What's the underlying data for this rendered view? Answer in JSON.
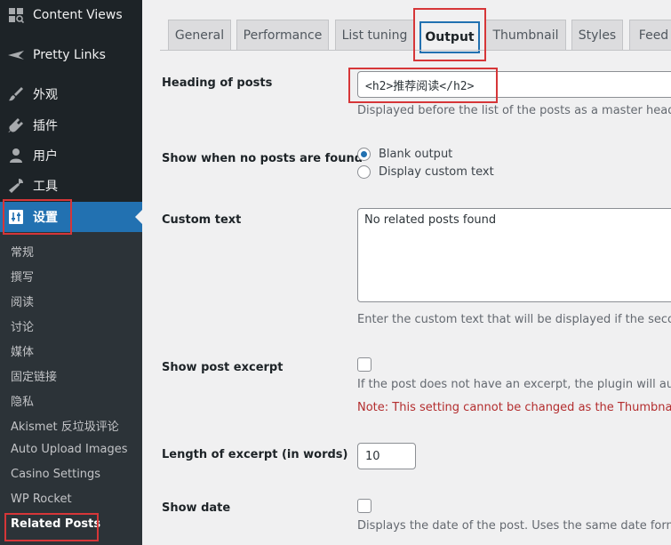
{
  "sidebar": {
    "menu": [
      {
        "label": "Content Views",
        "icon": "grid-icon"
      },
      {
        "label": "Pretty Links",
        "icon": "star-icon"
      },
      {
        "label": "外观",
        "icon": "paintbrush-icon"
      },
      {
        "label": "插件",
        "icon": "plugin-icon"
      },
      {
        "label": "用户",
        "icon": "user-icon"
      },
      {
        "label": "工具",
        "icon": "wrench-icon"
      },
      {
        "label": "设置",
        "icon": "settings-icon"
      }
    ],
    "submenu": [
      "常规",
      "撰写",
      "阅读",
      "讨论",
      "媒体",
      "固定链接",
      "隐私",
      "Akismet 反垃圾评论",
      "Auto Upload Images",
      "Casino Settings",
      "WP Rocket",
      "Related Posts"
    ]
  },
  "tabs": [
    "General",
    "Performance",
    "List tuning",
    "Output",
    "Thumbnail",
    "Styles",
    "Feed"
  ],
  "form": {
    "heading": {
      "label": "Heading of posts",
      "value": "<h2>推荐阅读</h2>",
      "desc": "Displayed before the list of the posts as a master heading"
    },
    "no_posts": {
      "label": "Show when no posts are found",
      "options": [
        "Blank output",
        "Display custom text"
      ],
      "selected": "Blank output"
    },
    "custom_text": {
      "label": "Custom text",
      "value": "No related posts found",
      "desc": "Enter the custom text that will be displayed if the second"
    },
    "excerpt": {
      "label": "Show post excerpt",
      "desc": "If the post does not have an excerpt, the plugin will autor",
      "note": "Note: This setting cannot be changed as the Thumbnail st"
    },
    "excerpt_length": {
      "label": "Length of excerpt (in words)",
      "value": "10"
    },
    "show_date": {
      "label": "Show date",
      "desc": "Displays the date of the post. Uses the same date format"
    }
  },
  "colors": {
    "sidebar": "#1d2327",
    "submenu": "#2c3338",
    "accent": "#2271b1",
    "annotation": "#d63638",
    "note": "#b32d2e"
  }
}
